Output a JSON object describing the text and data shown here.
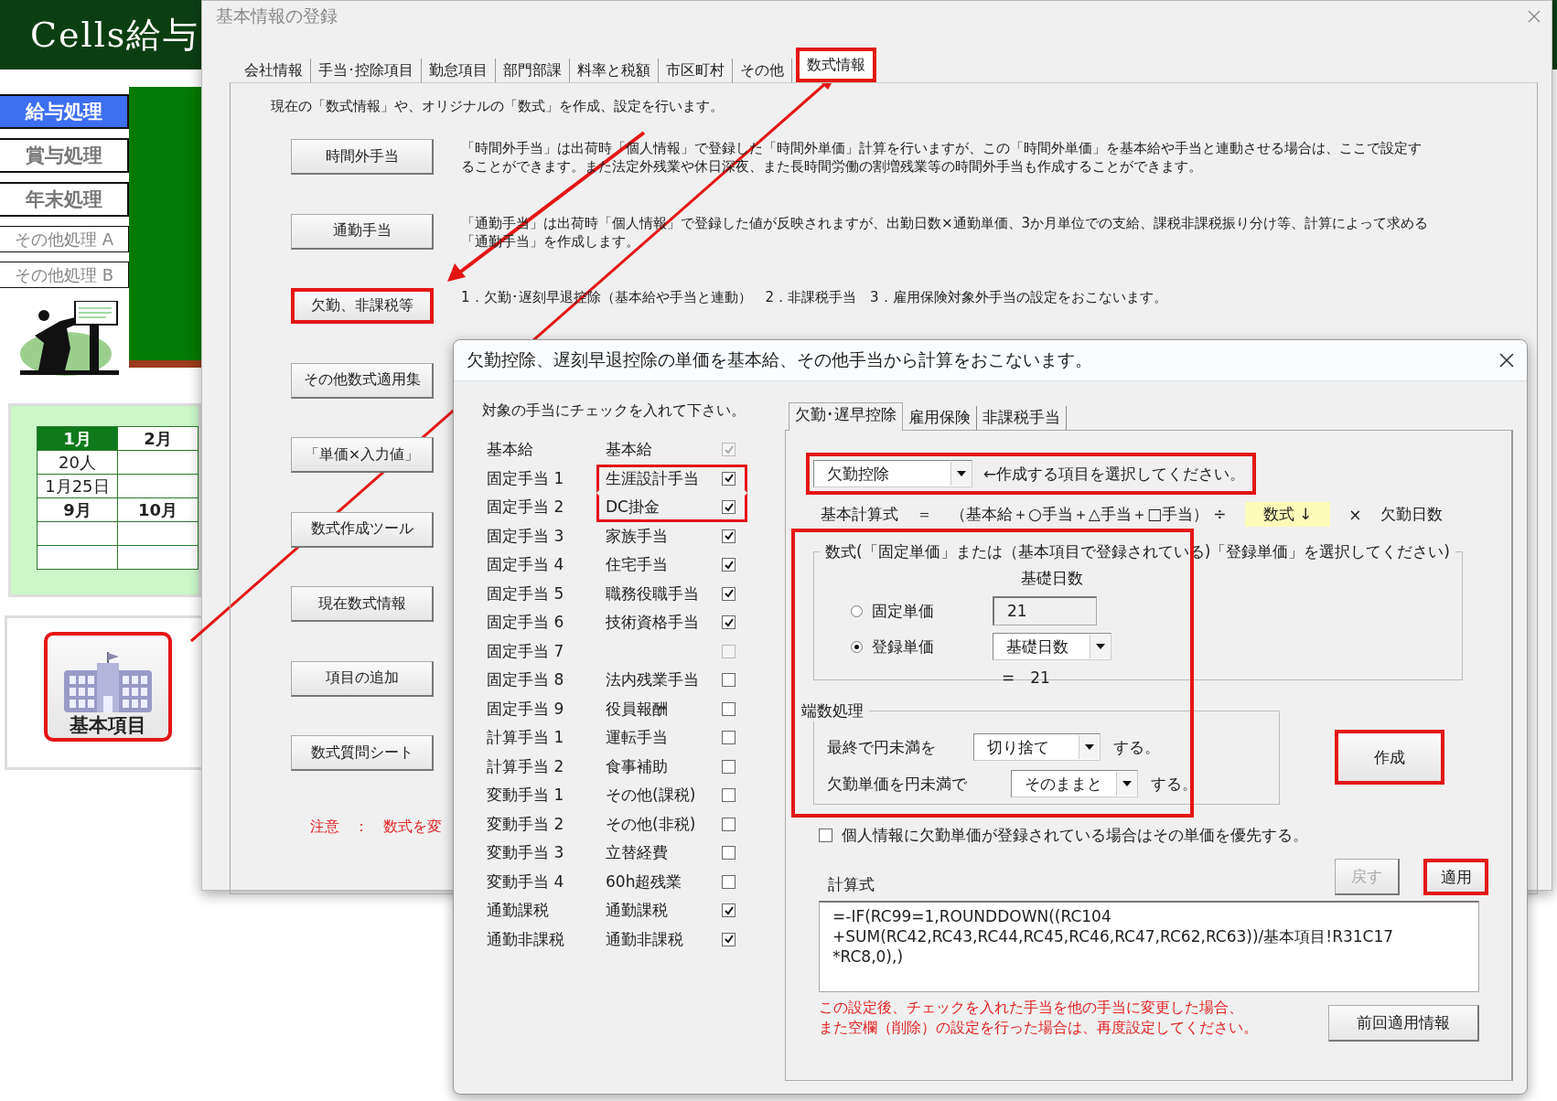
{
  "sheet": {
    "title": "Cells給与",
    "menu": [
      {
        "label": "給与処理",
        "kind": "main",
        "selected": true
      },
      {
        "label": "賞与処理",
        "kind": "main",
        "selected": false
      },
      {
        "label": "年末処理",
        "kind": "main",
        "selected": false
      },
      {
        "label": "その他処理 A",
        "kind": "other",
        "selected": false
      },
      {
        "label": "その他処理 B",
        "kind": "other",
        "selected": false
      }
    ],
    "calendar": [
      {
        "kind": "month",
        "cells": [
          {
            "text": "1月",
            "selected": true
          },
          {
            "text": "2月",
            "selected": false
          }
        ]
      },
      {
        "kind": "value",
        "cells": [
          {
            "text": "20人",
            "selected": false
          }
        ]
      },
      {
        "kind": "value",
        "cells": [
          {
            "text": "1月25日",
            "selected": false
          }
        ]
      },
      {
        "kind": "month",
        "cells": [
          {
            "text": "9月",
            "selected": false
          },
          {
            "text": "10月",
            "selected": false
          }
        ]
      }
    ],
    "master_button": {
      "label": "基本項目",
      "highlighted": true
    }
  },
  "main_dialog": {
    "title": "基本情報の登録",
    "tabs": [
      {
        "label": "会社情報",
        "selected": false,
        "highlighted": false
      },
      {
        "label": "手当･控除項目",
        "selected": false,
        "highlighted": false
      },
      {
        "label": "勤怠項目",
        "selected": false,
        "highlighted": false
      },
      {
        "label": "部門部課",
        "selected": false,
        "highlighted": false
      },
      {
        "label": "料率と税額",
        "selected": false,
        "highlighted": false
      },
      {
        "label": "市区町村",
        "selected": false,
        "highlighted": false
      },
      {
        "label": "その他",
        "selected": false,
        "highlighted": false
      },
      {
        "label": "数式情報",
        "selected": true,
        "highlighted": true
      }
    ],
    "intro": "現在の「数式情報」や、オリジナルの「数式」を作成、設定を行います。",
    "rows": [
      {
        "button": "時間外手当",
        "highlighted": false,
        "description": "「時間外手当」は出荷時「個人情報」で登録した「時間外単価」計算を行いますが、この「時間外単価」を基本給や手当と連動させる場合は、ここで設定することができます。また法定外残業や休日深夜、また長時間労働の割増残業等の時間外手当も作成することができます。"
      },
      {
        "button": "通勤手当",
        "highlighted": false,
        "description": "「通勤手当」は出荷時「個人情報」で登録した値が反映されますが、出勤日数×通勤単価、3か月単位での支給、課税非課税振り分け等、計算によって求める「通勤手当」を作成します。"
      },
      {
        "button": "欠勤、非課税等",
        "highlighted": true,
        "description": "1．欠勤･遅刻早退控除（基本給や手当と連動）　2．非課税手当　3．雇用保険対象外手当の設定をおこないます。"
      },
      {
        "button": "その他数式適用集",
        "highlighted": false
      },
      {
        "button": "「単価×入力値」",
        "highlighted": false
      },
      {
        "button": "数式作成ツール",
        "highlighted": false
      },
      {
        "button": "現在数式情報",
        "highlighted": false
      },
      {
        "button": "項目の追加",
        "highlighted": false
      },
      {
        "button": "数式質問シート",
        "highlighted": false
      }
    ],
    "notice": "注意　：　数式を変"
  },
  "sub_dialog": {
    "title": "欠勤控除、遅刻早退控除の単価を基本給、その他手当から計算をおこないます。",
    "instruction": "対象の手当にチェックを入れて下さい。",
    "allowances": [
      {
        "slot": "基本給",
        "name": "基本給",
        "checked": true,
        "disabled": true,
        "highlighted": false
      },
      {
        "slot": "固定手当 1",
        "name": "生涯設計手当",
        "checked": true,
        "disabled": false,
        "highlighted": true
      },
      {
        "slot": "固定手当 2",
        "name": "DC掛金",
        "checked": true,
        "disabled": false,
        "highlighted": true
      },
      {
        "slot": "固定手当 3",
        "name": "家族手当",
        "checked": true,
        "disabled": false,
        "highlighted": false
      },
      {
        "slot": "固定手当 4",
        "name": "住宅手当",
        "checked": true,
        "disabled": false,
        "highlighted": false
      },
      {
        "slot": "固定手当 5",
        "name": "職務役職手当",
        "checked": true,
        "disabled": false,
        "highlighted": false
      },
      {
        "slot": "固定手当 6",
        "name": "技術資格手当",
        "checked": true,
        "disabled": false,
        "highlighted": false
      },
      {
        "slot": "固定手当 7",
        "checked": false,
        "disabled": true,
        "highlighted": false
      },
      {
        "slot": "固定手当 8",
        "name": "法内残業手当",
        "checked": false,
        "disabled": false,
        "highlighted": false
      },
      {
        "slot": "固定手当 9",
        "name": "役員報酬",
        "checked": false,
        "disabled": false,
        "highlighted": false
      },
      {
        "slot": "計算手当 1",
        "name": "運転手当",
        "checked": false,
        "disabled": false,
        "highlighted": false
      },
      {
        "slot": "計算手当 2",
        "name": "食事補助",
        "checked": false,
        "disabled": false,
        "highlighted": false
      },
      {
        "slot": "変動手当 1",
        "name": "その他(課税)",
        "checked": false,
        "disabled": false,
        "highlighted": false
      },
      {
        "slot": "変動手当 2",
        "name": "その他(非税)",
        "checked": false,
        "disabled": false,
        "highlighted": false
      },
      {
        "slot": "変動手当 3",
        "name": "立替経費",
        "checked": false,
        "disabled": false,
        "highlighted": false
      },
      {
        "slot": "変動手当 4",
        "name": "60h超残業",
        "checked": false,
        "disabled": false,
        "highlighted": false
      },
      {
        "slot": "通勤課税",
        "name": "通勤課税",
        "checked": true,
        "disabled": false,
        "highlighted": false
      },
      {
        "slot": "通勤非課税",
        "name": "通勤非課税",
        "checked": true,
        "disabled": false,
        "highlighted": false
      }
    ],
    "tabs": [
      {
        "label": "欠勤･遅早控除",
        "selected": true
      },
      {
        "label": "雇用保険",
        "selected": false
      },
      {
        "label": "非課税手当",
        "selected": false
      }
    ],
    "item_select": {
      "value": "欠勤控除",
      "hint": "←作成する項目を選択してください。",
      "highlighted": true
    },
    "formula_line": [
      {
        "text": "基本計算式",
        "kind": "plain"
      },
      {
        "text": "＝",
        "kind": "plain"
      },
      {
        "text": "（基本給＋○手当＋△手当＋□手当） ÷",
        "kind": "plain"
      },
      {
        "text": "数式 ↓",
        "kind": "badge"
      },
      {
        "text": "×",
        "kind": "plain"
      },
      {
        "text": "欠勤日数",
        "kind": "plain"
      }
    ],
    "unit_price": {
      "legend": "数式(「固定単価」または（基本項目で登録されている)「登録単価」を選択してください)",
      "highlighted": true,
      "column_header": "基礎日数",
      "options": [
        {
          "label": "固定単価",
          "selected": false,
          "kind": "field",
          "value": "21"
        },
        {
          "label": "登録単価",
          "selected": true,
          "kind": "dropdown",
          "value": "基礎日数"
        }
      ],
      "result": "=　21"
    },
    "rounding": {
      "legend": "端数処理",
      "rows": [
        {
          "label": "最終で円未満を",
          "value": "切り捨て",
          "suffix": "する。"
        },
        {
          "label": "欠勤単価を円未満で",
          "value": "そのままと",
          "suffix": "する。"
        }
      ]
    },
    "create_button": {
      "label": "作成",
      "highlighted": true
    },
    "prefer_personal": {
      "label": "個人情報に欠勤単価が登録されている場合はその単価を優先する。",
      "checked": false
    },
    "formula_label": "計算式",
    "back_button": {
      "label": "戻す",
      "disabled": true
    },
    "apply_button": {
      "label": "適用",
      "highlighted": true
    },
    "formula": "=-IF(RC99=1,ROUNDDOWN((RC104\n+SUM(RC42,RC43,RC44,RC45,RC46,RC47,RC62,RC63))/基本項目!R31C17\n*RC8,0),)",
    "note": [
      "この設定後、チェックを入れた手当を他の手当に変更した場合、",
      "また空欄（削除）の設定を行った場合は、再度設定してください。"
    ],
    "previous_button": {
      "label": "前回適用情報"
    }
  }
}
